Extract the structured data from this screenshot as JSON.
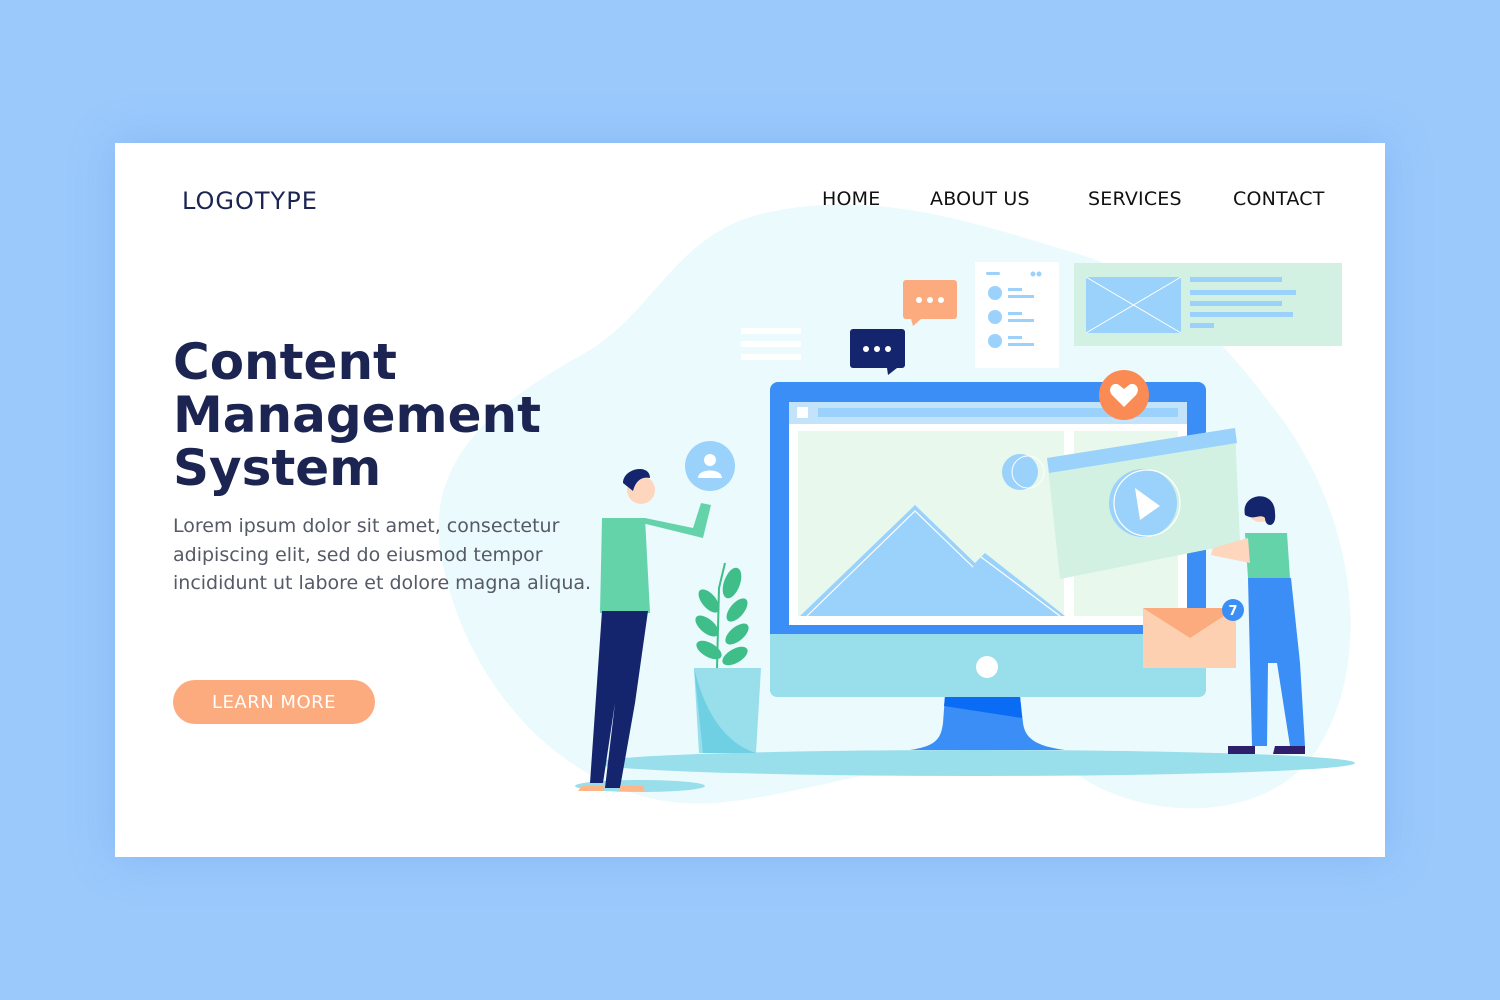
{
  "header": {
    "logo": "LOGOTYPE",
    "nav": [
      {
        "label": "HOME"
      },
      {
        "label": "ABOUT US"
      },
      {
        "label": "SERVICES"
      },
      {
        "label": "CONTACT"
      }
    ]
  },
  "hero": {
    "title_lines": [
      "Content",
      "Management",
      "System"
    ],
    "body": "Lorem ipsum dolor sit amet, consectetur adipiscing elit, sed do eiusmod tempor incididunt ut labore et dolore magna aliqua.",
    "cta_label": "LEARN MORE"
  },
  "illustration": {
    "mail_badge_count": "7",
    "icons": [
      "chat-bubble-icon",
      "user-avatar-icon",
      "heart-icon",
      "play-icon",
      "envelope-icon",
      "image-placeholder-icon"
    ]
  },
  "colors": {
    "background": "#9bc9fc",
    "card": "#ffffff",
    "title": "#1c2552",
    "accent_orange": "#fcab7f",
    "accent_blue": "#3a8ef6",
    "light_blue": "#9ad2fb",
    "mint": "#d2f1e2",
    "blob": "#eafafd"
  }
}
